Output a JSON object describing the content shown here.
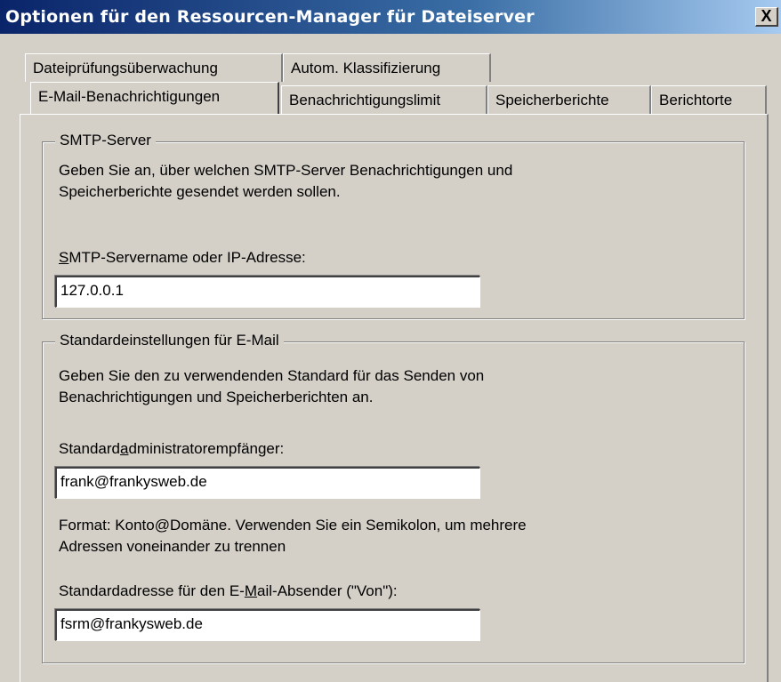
{
  "window": {
    "title": "Optionen für den Ressourcen-Manager für Dateiserver",
    "close_label": "X"
  },
  "tabs_back": [
    {
      "label": "Dateiprüfungsüberwachung"
    },
    {
      "label": "Autom. Klassifizierung"
    }
  ],
  "tabs_front": [
    {
      "label": "E-Mail-Benachrichtigungen",
      "active": true
    },
    {
      "label": "Benachrichtigungslimit"
    },
    {
      "label": "Speicherberichte"
    },
    {
      "label": "Berichtorte"
    }
  ],
  "smtp_group": {
    "legend": "SMTP-Server",
    "description_line1": "Geben Sie an, über welchen SMTP-Server Benachrichtigungen und",
    "description_line2": "Speicherberichte gesendet werden sollen.",
    "field_label_access": "S",
    "field_label_rest": "MTP-Servername oder IP-Adresse:",
    "field_value": "127.0.0.1"
  },
  "email_group": {
    "legend": "Standardeinstellungen für E-Mail",
    "description_line1": "Geben Sie den zu verwendenden Standard für das Senden von",
    "description_line2": "Benachrichtigungen und Speicherberichten an.",
    "admin_label_pre": "Standard",
    "admin_label_access": "a",
    "admin_label_post": "dministratorempfänger:",
    "admin_value": "frank@frankysweb.de",
    "format_line1": "Format: Konto@Domäne. Verwenden Sie ein Semikolon, um mehrere",
    "format_line2": "Adressen voneinander zu trennen",
    "sender_label_pre": "Standardadresse für den E-",
    "sender_label_access": "M",
    "sender_label_post": "ail-Absender (\"Von\"):",
    "sender_value": "fsrm@frankysweb.de"
  }
}
